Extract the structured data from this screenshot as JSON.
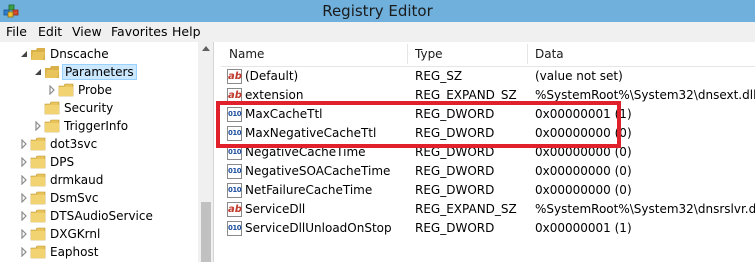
{
  "window": {
    "title": "Registry Editor"
  },
  "menu": [
    "File",
    "Edit",
    "View",
    "Favorites",
    "Help"
  ],
  "tree": [
    {
      "label": "Dnscache",
      "indent": 2,
      "arrow": "expanded",
      "selected": false
    },
    {
      "label": "Parameters",
      "indent": 3,
      "arrow": "expanded",
      "selected": true
    },
    {
      "label": "Probe",
      "indent": 4,
      "arrow": "collapsed",
      "selected": false
    },
    {
      "label": "Security",
      "indent": 3,
      "arrow": "none",
      "selected": false
    },
    {
      "label": "TriggerInfo",
      "indent": 3,
      "arrow": "collapsed",
      "selected": false
    },
    {
      "label": "dot3svc",
      "indent": 2,
      "arrow": "collapsed",
      "selected": false
    },
    {
      "label": "DPS",
      "indent": 2,
      "arrow": "collapsed",
      "selected": false
    },
    {
      "label": "drmkaud",
      "indent": 2,
      "arrow": "collapsed",
      "selected": false
    },
    {
      "label": "DsmSvc",
      "indent": 2,
      "arrow": "collapsed",
      "selected": false
    },
    {
      "label": "DTSAudioService",
      "indent": 2,
      "arrow": "collapsed",
      "selected": false
    },
    {
      "label": "DXGKrnl",
      "indent": 2,
      "arrow": "collapsed",
      "selected": false
    },
    {
      "label": "Eaphost",
      "indent": 2,
      "arrow": "collapsed",
      "selected": false
    }
  ],
  "columns": {
    "name": "Name",
    "type": "Type",
    "data": "Data"
  },
  "values": [
    {
      "icon": "ab",
      "name": "(Default)",
      "type": "REG_SZ",
      "data": "(value not set)"
    },
    {
      "icon": "ab",
      "name": "extension",
      "type": "REG_EXPAND_SZ",
      "data": "%SystemRoot%\\System32\\dnsext.dll"
    },
    {
      "icon": "010",
      "name": "MaxCacheTtl",
      "type": "REG_DWORD",
      "data": "0x00000001 (1)"
    },
    {
      "icon": "010",
      "name": "MaxNegativeCacheTtl",
      "type": "REG_DWORD",
      "data": "0x00000000 (0)"
    },
    {
      "icon": "010",
      "name": "NegativeCacheTime",
      "type": "REG_DWORD",
      "data": "0x00000000 (0)"
    },
    {
      "icon": "010",
      "name": "NegativeSOACacheTime",
      "type": "REG_DWORD",
      "data": "0x00000000 (0)"
    },
    {
      "icon": "010",
      "name": "NetFailureCacheTime",
      "type": "REG_DWORD",
      "data": "0x00000000 (0)"
    },
    {
      "icon": "ab",
      "name": "ServiceDll",
      "type": "REG_EXPAND_SZ",
      "data": "%SystemRoot%\\System32\\dnsrslvr.dll"
    },
    {
      "icon": "010",
      "name": "ServiceDllUnloadOnStop",
      "type": "REG_DWORD",
      "data": "0x00000001 (1)"
    }
  ],
  "colors": {
    "titlebar": "#6fb0dc",
    "highlight": "#e0212b",
    "folder": "#e8c45a",
    "selection": "#cce8ff"
  }
}
